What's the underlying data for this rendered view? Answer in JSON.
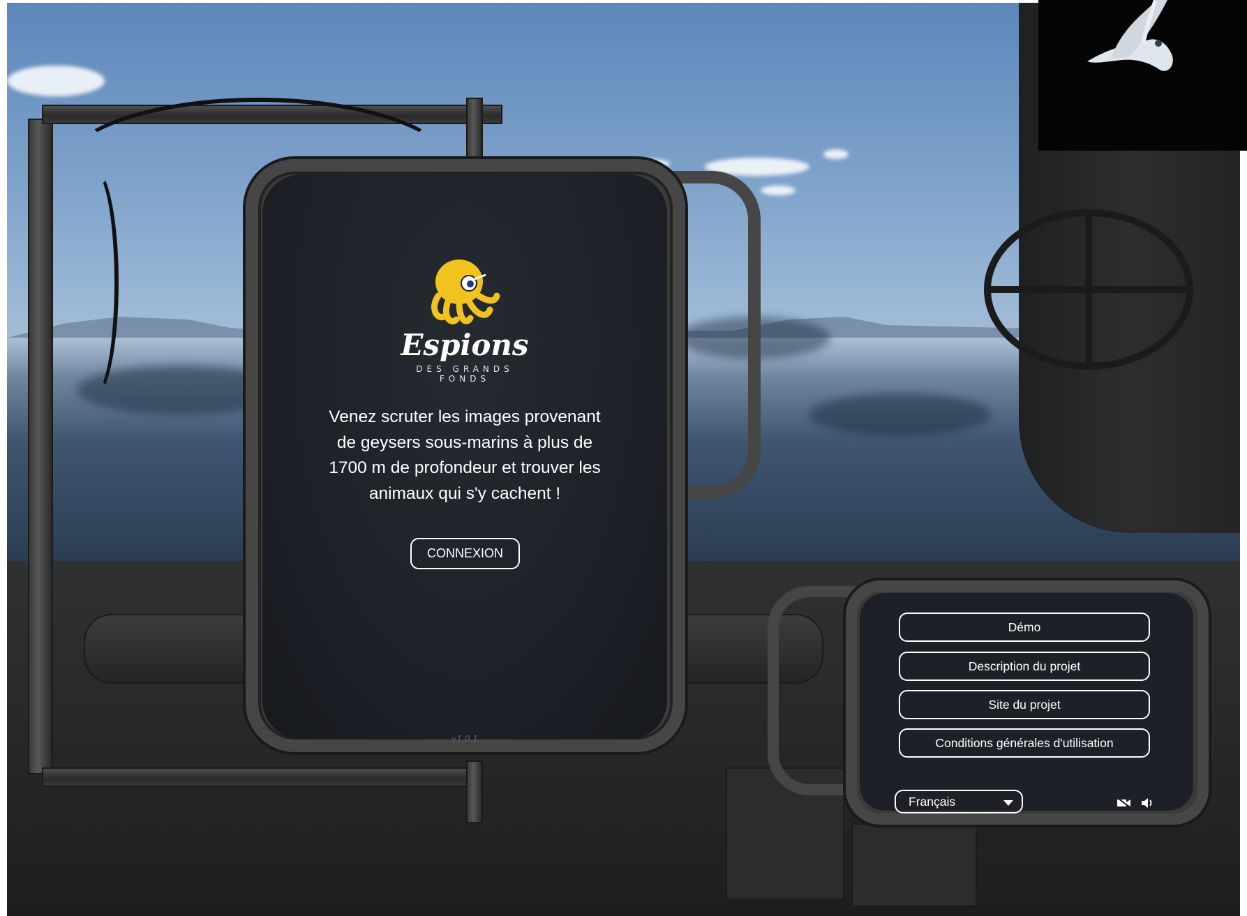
{
  "brand": {
    "name": "Espions",
    "subtitle": "DES GRANDS FONDS"
  },
  "main": {
    "tagline_lines": [
      "Venez scruter les images provenant",
      "de geysers sous-marins à plus de",
      "1700 m de profondeur et trouver les",
      "animaux qui s'y cachent !"
    ],
    "connexion_label": "CONNEXION",
    "version": "v1.0.1"
  },
  "menu": {
    "items": [
      {
        "label": "Démo"
      },
      {
        "label": "Description du projet"
      },
      {
        "label": "Site du projet"
      },
      {
        "label": "Conditions générales d'utilisation"
      }
    ],
    "language": "Français"
  },
  "icons": {
    "camera": "video-camera-icon",
    "sound": "speaker-icon",
    "logo": "octopus-logo-icon"
  },
  "colors": {
    "logo_yellow": "#f2c21f",
    "panel_bg": "#1d2026",
    "text": "#ffffff"
  }
}
